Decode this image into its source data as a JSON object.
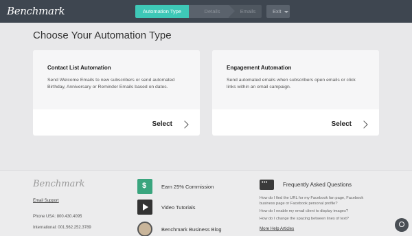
{
  "topbar": {
    "logo": "Benchmark",
    "steps": [
      "Automation Type",
      "Details",
      "Emails"
    ],
    "exit_label": "Exit"
  },
  "main": {
    "title": "Choose Your Automation Type",
    "cards": [
      {
        "title": "Contact List Automation",
        "description": "Send Welcome Emails to new subscribers or send automated Birthday, Anniversary or Reminder Emails based on dates.",
        "select_label": "Select"
      },
      {
        "title": "Engagement Automation",
        "description": "Send automated emails when subscribers open emails or click links within an email campaign.",
        "select_label": "Select"
      }
    ]
  },
  "footer": {
    "logo": "Benchmark",
    "email_support": "Email Support",
    "phone_usa": "Phone USA:  800.430.4095",
    "international": "International:  001.562.252.3789",
    "links": [
      {
        "label": "Earn 25% Commission",
        "icon": "money-icon"
      },
      {
        "label": "Video Tutorials",
        "icon": "video-icon"
      },
      {
        "label": "Benchmark Business Blog",
        "icon": "blog-avatar-icon"
      }
    ],
    "faq": {
      "title": "Frequently Asked Questions",
      "questions": [
        "How do I find the URL for my Facebook fan page, Facebook business page or Facebook personal profile?",
        "How do I enable my email client to display images?",
        "How do I change the spacing between lines of text?"
      ],
      "more": "More Help Articles"
    }
  }
}
